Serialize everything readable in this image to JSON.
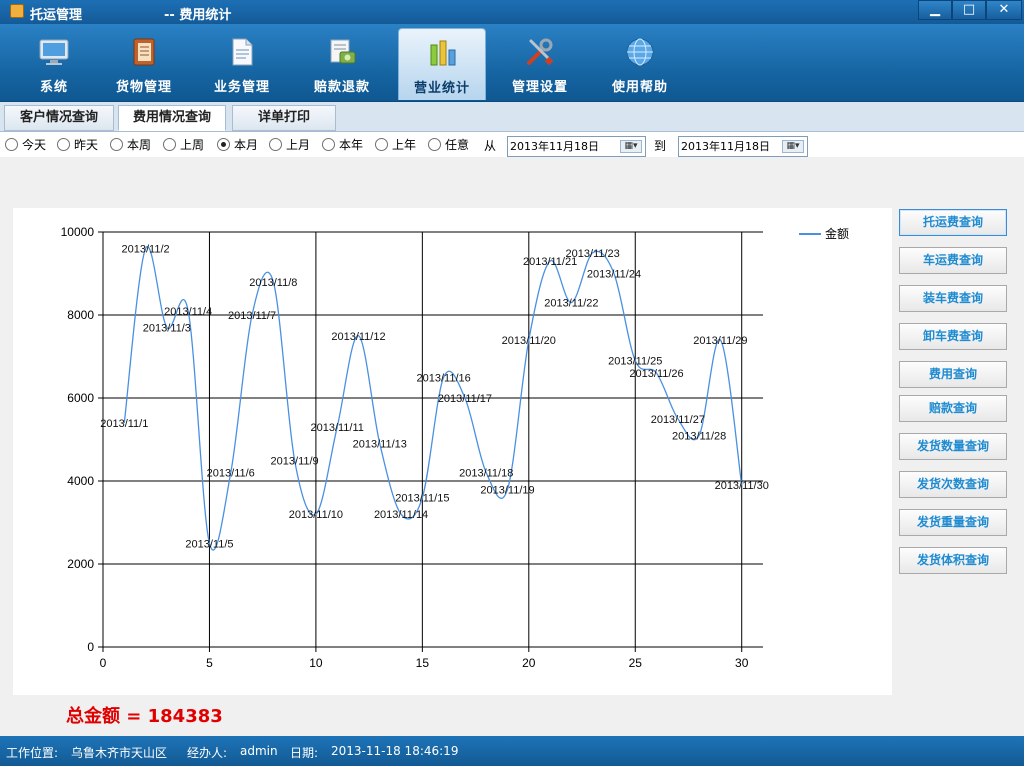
{
  "window": {
    "title": "托运管理",
    "subtitle": "-- 费用统计",
    "min_label": "▁",
    "max_label": "□",
    "close_label": "✕"
  },
  "nav": [
    {
      "label": "系统",
      "icon": "monitor-icon"
    },
    {
      "label": "货物管理",
      "icon": "book-icon"
    },
    {
      "label": "业务管理",
      "icon": "document-icon"
    },
    {
      "label": "赔款退款",
      "icon": "money-icon"
    },
    {
      "label": "营业统计",
      "icon": "bar-chart-icon",
      "active": true
    },
    {
      "label": "管理设置",
      "icon": "tools-icon"
    },
    {
      "label": "使用帮助",
      "icon": "globe-icon"
    }
  ],
  "subtabs": [
    {
      "label": "客户情况查询"
    },
    {
      "label": "费用情况查询",
      "active": true
    },
    {
      "label": "详单打印"
    }
  ],
  "filters": {
    "radios": [
      "今天",
      "昨天",
      "本周",
      "上周",
      "本月",
      "上月",
      "本年",
      "上年",
      "任意"
    ],
    "selected": "本月",
    "from_label": "从",
    "to_label": "到",
    "from_date": "2013年11月18日",
    "to_date": "2013年11月18日"
  },
  "side_buttons": [
    "托运费查询",
    "车运费查询",
    "装车费查询",
    "卸车费查询",
    "费用查询",
    "赔款查询",
    "发货数量查询",
    "发货次数查询",
    "发货重量查询",
    "发货体积查询"
  ],
  "total": "总金额 = 184383",
  "status": {
    "location_label": "工作位置:",
    "location": "乌鲁木齐市天山区",
    "operator_label": "经办人:",
    "operator": "admin",
    "date_label": "日期:",
    "date": "2013-11-18 18:46:19"
  },
  "colors": {
    "series": "#4a90e2",
    "accent": "#1e74b8",
    "total": "#e00000"
  },
  "chart_data": {
    "type": "line",
    "series": [
      {
        "name": "金额",
        "x": [
          1,
          2,
          3,
          4,
          5,
          6,
          7,
          8,
          9,
          10,
          11,
          12,
          13,
          14,
          15,
          16,
          17,
          18,
          19,
          20,
          21,
          22,
          23,
          24,
          25,
          26,
          27,
          28,
          29,
          30
        ],
        "values": [
          5400,
          9600,
          7700,
          8100,
          2500,
          4200,
          8000,
          8800,
          4500,
          3200,
          5300,
          7500,
          4900,
          3200,
          3600,
          6500,
          6000,
          4200,
          3800,
          7400,
          9300,
          8300,
          9500,
          9000,
          6900,
          6600,
          5500,
          5100,
          7400,
          3900
        ],
        "labels": [
          "2013/11/1",
          "2013/11/2",
          "2013/11/3",
          "2013/11/4",
          "2013/11/5",
          "2013/11/6",
          "2013/11/7",
          "2013/11/8",
          "2013/11/9",
          "2013/11/10",
          "2013/11/11",
          "2013/11/12",
          "2013/11/13",
          "2013/11/14",
          "2013/11/15",
          "2013/11/16",
          "2013/11/17",
          "2013/11/18",
          "2013/11/19",
          "2013/11/20",
          "2013/11/21",
          "2013/11/22",
          "2013/11/23",
          "2013/11/24",
          "2013/11/25",
          "2013/11/26",
          "2013/11/27",
          "2013/11/28",
          "2013/11/29",
          "2013/11/30"
        ]
      }
    ],
    "xlim": [
      0,
      31
    ],
    "ylim": [
      0,
      10000
    ],
    "xticks": [
      0,
      5,
      10,
      15,
      20,
      25,
      30
    ],
    "yticks": [
      0,
      2000,
      4000,
      6000,
      8000,
      10000
    ],
    "grid": true,
    "smooth": true,
    "legend": "top-right"
  }
}
